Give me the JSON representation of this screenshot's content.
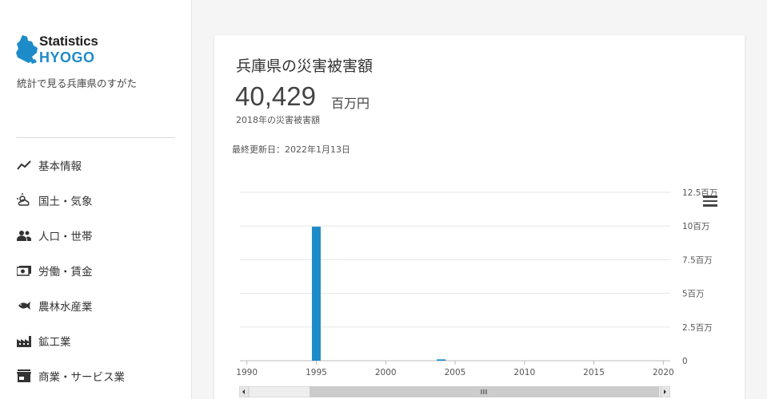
{
  "brand": {
    "line1": "Statistics",
    "line2": "HYOGO",
    "tagline": "統計で見る兵庫県のすがた",
    "accent": "#1e8bc9"
  },
  "nav": [
    {
      "label": "基本情報",
      "icon": "trend-line-icon"
    },
    {
      "label": "国土・気象",
      "icon": "weather-icon"
    },
    {
      "label": "人口・世帯",
      "icon": "people-icon"
    },
    {
      "label": "労働・賃金",
      "icon": "money-icon"
    },
    {
      "label": "農林水産業",
      "icon": "fish-icon"
    },
    {
      "label": "鉱工業",
      "icon": "factory-icon"
    },
    {
      "label": "商業・サービス業",
      "icon": "store-icon"
    }
  ],
  "card": {
    "title": "兵庫県の災害被害額",
    "value": "40,429",
    "unit": "百万円",
    "subtitle": "2018年の災害被害額",
    "updated": "最終更新日：2022年1月13日"
  },
  "chart_data": {
    "type": "bar",
    "x_ticks": [
      "1990",
      "1995",
      "2000",
      "2005",
      "2010",
      "2015",
      "2020"
    ],
    "y_ticks": [
      "0",
      "2.5百万",
      "5百万",
      "7.5百万",
      "10百万",
      "12.5百万"
    ],
    "ylim": [
      0,
      12500000
    ],
    "xlim": [
      1989.5,
      2020.5
    ],
    "bar_color": "#1e8bc9",
    "points": [
      {
        "x": 1995,
        "y": 9950000
      },
      {
        "x": 2004,
        "y": 100000
      }
    ],
    "grid": true,
    "y_axis_side": "right"
  }
}
